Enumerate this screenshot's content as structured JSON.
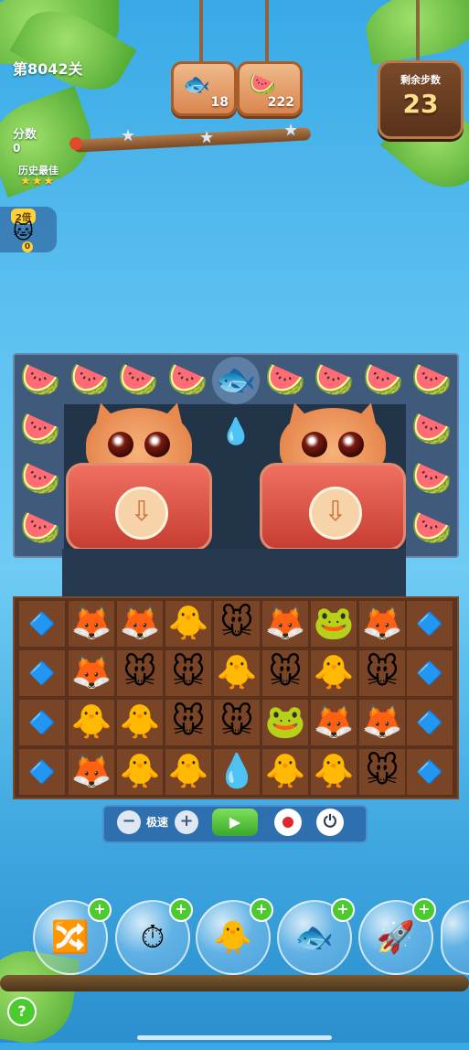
{
  "header": {
    "level": "第8042关",
    "score_label": "分数",
    "score_value": "0",
    "best_label": "历史最佳",
    "best_stars": "★★★",
    "progress_star_icon": "★"
  },
  "goals": [
    {
      "icon": "fish-cookie-icon",
      "glyph": "🐟",
      "count": "18"
    },
    {
      "icon": "ice-pop-icon",
      "glyph": "🍉",
      "count": "222"
    }
  ],
  "moves": {
    "label": "剩余步数",
    "value": "23"
  },
  "multiplier": {
    "tag": "2倍",
    "count": "0",
    "glyph": "🐱"
  },
  "board": {
    "top_glyph": "🍉",
    "bottle_glyph": "🐟",
    "drop_glyph": "💧",
    "cage_arrow": "⇩",
    "side_glyph": "🔷",
    "rows": [
      [
        "🦊",
        "🦊",
        "🐥",
        "🐭",
        "🦊",
        "🐸",
        "🦊"
      ],
      [
        "🦊",
        "🐭",
        "🐭",
        "🐥",
        "🐭",
        "🐥",
        "🐭"
      ],
      [
        "🐥",
        "🐥",
        "🐭",
        "🐭",
        "🐸",
        "🦊",
        "🦊"
      ],
      [
        "🦊",
        "🐥",
        "🐥",
        "💧",
        "🐥",
        "🐥",
        "🐭"
      ]
    ]
  },
  "controls": {
    "minus": "−",
    "speed_label": "极速",
    "plus": "+",
    "play": "▶",
    "power": "⏻"
  },
  "boosters": [
    {
      "icon": "shuffle-booster-icon",
      "glyph": "🔀"
    },
    {
      "icon": "clock-booster-icon",
      "glyph": "⏱"
    },
    {
      "icon": "swap-booster-icon",
      "glyph": "🐥"
    },
    {
      "icon": "fish-booster-icon",
      "glyph": "🐟"
    },
    {
      "icon": "rocket-booster-icon",
      "glyph": "🚀"
    }
  ],
  "plus_glyph": "+",
  "help": "?"
}
